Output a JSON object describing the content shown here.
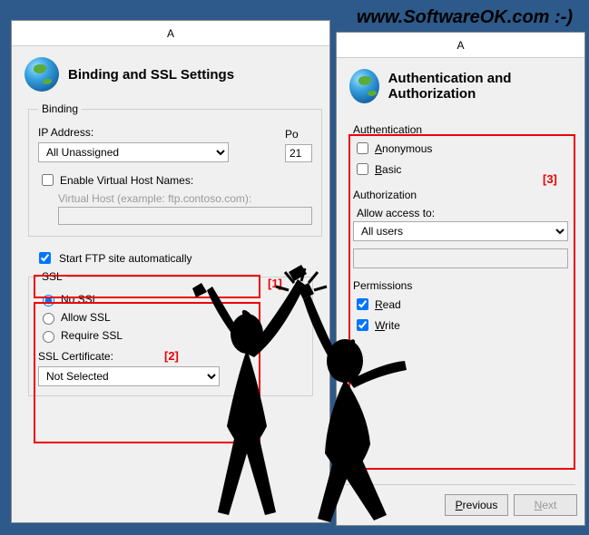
{
  "watermark": "www.SoftwareOK.com :-)",
  "left": {
    "titlebar": "A",
    "title": "Binding and SSL Settings",
    "binding": {
      "legend": "Binding",
      "ip_label": "IP Address:",
      "ip_value": "All Unassigned",
      "port_label": "Po",
      "port_value": "21",
      "vhost_check": "Enable Virtual Host Names:",
      "vhost_label": "Virtual Host (example: ftp.contoso.com):",
      "vhost_value": ""
    },
    "autostart": "Start FTP site automatically",
    "ssl": {
      "legend": "SSL",
      "no": "No SSL",
      "allow": "Allow SSL",
      "require": "Require SSL",
      "cert_label": "SSL Certificate:",
      "cert_value": "Not Selected"
    },
    "markers": {
      "m1": "[1]",
      "m2": "[2]"
    }
  },
  "right": {
    "titlebar": "A",
    "title": "Authentication and Authorization",
    "auth": {
      "legend": "Authentication",
      "anon": "Anonymous",
      "basic": "Basic"
    },
    "authorization": {
      "legend": "Authorization",
      "allow_label": "Allow access to:",
      "allow_value": "All users"
    },
    "permissions": {
      "legend": "Permissions",
      "read": "Read",
      "write": "Write"
    },
    "buttons": {
      "prev": "Previous",
      "next": "Next"
    },
    "marker": "[3]"
  }
}
